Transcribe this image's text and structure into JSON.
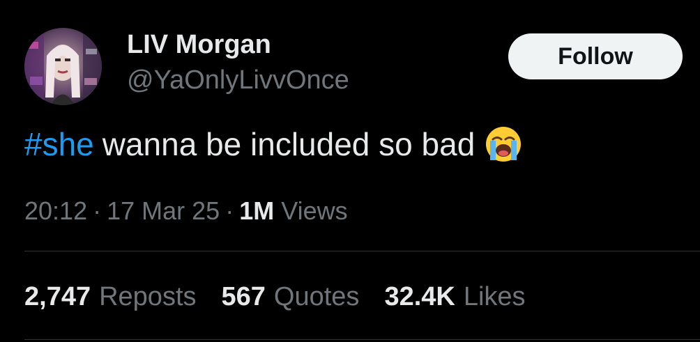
{
  "author": {
    "display_name": "LIV Morgan",
    "handle": "@YaOnlyLivvOnce"
  },
  "follow_button": {
    "label": "Follow"
  },
  "tweet": {
    "hashtag": "#she",
    "text": "wanna be included so bad",
    "emoji": "loudly-crying-face-icon"
  },
  "meta": {
    "time": "20:12",
    "date": "17 Mar 25",
    "views_count": "1M",
    "views_label": "Views"
  },
  "stats": [
    {
      "count": "2,747",
      "label": "Reposts"
    },
    {
      "count": "567",
      "label": "Quotes"
    },
    {
      "count": "32.4K",
      "label": "Likes"
    }
  ],
  "colors": {
    "background": "#000000",
    "text_primary": "#e7e9ea",
    "text_secondary": "#71767b",
    "accent": "#1d9bf0",
    "divider": "#2f3336",
    "follow_bg": "#eff3f4"
  }
}
